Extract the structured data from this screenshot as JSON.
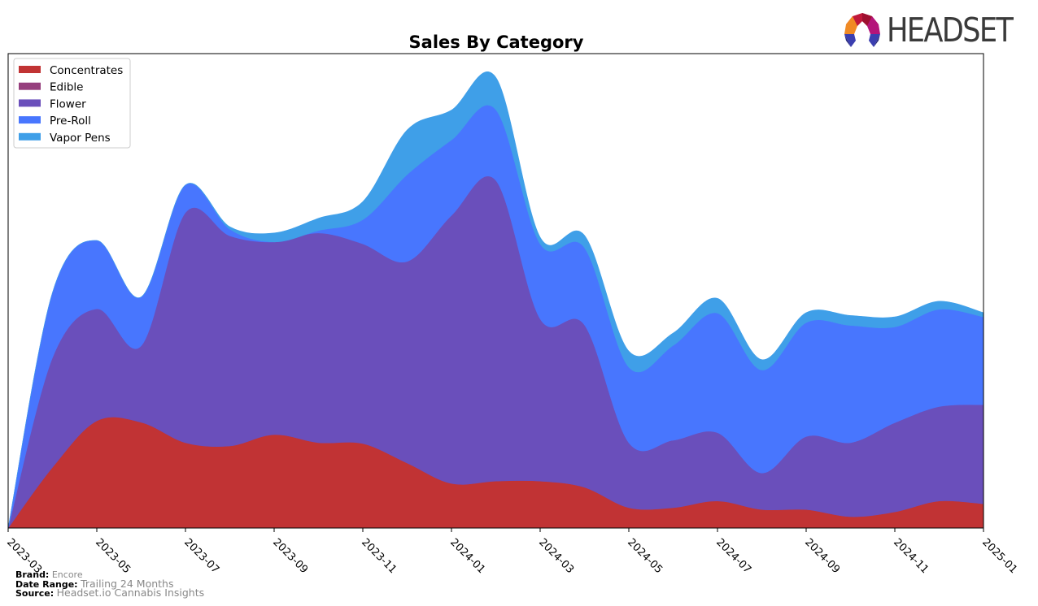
{
  "header": {
    "logo_text": "HEADSET"
  },
  "footer": {
    "brand_label": "Brand:",
    "brand_value": "Encore",
    "date_range_label": "Date Range:",
    "date_range_value": "Trailing 24 Months",
    "source_label": "Source:",
    "source_value": "Headset.io Cannabis Insights"
  },
  "chart_data": {
    "type": "area",
    "stacked": true,
    "smooth": true,
    "title": "Sales By Category",
    "xlabel": "",
    "ylabel": "",
    "y_axis_visible": false,
    "ylim": [
      0,
      100
    ],
    "grid": false,
    "legend_position": "top-left",
    "x": [
      "2023-03",
      "2023-04",
      "2023-05",
      "2023-06",
      "2023-07",
      "2023-08",
      "2023-09",
      "2023-10",
      "2023-11",
      "2023-12",
      "2024-01",
      "2024-02",
      "2024-03",
      "2024-04",
      "2024-05",
      "2024-06",
      "2024-07",
      "2024-08",
      "2024-09",
      "2024-10",
      "2024-11",
      "2024-12",
      "2025-01"
    ],
    "x_tick_labels": [
      "2023-03",
      "2023-05",
      "2023-07",
      "2023-09",
      "2023-11",
      "2024-01",
      "2024-03",
      "2024-05",
      "2024-07",
      "2024-09",
      "2024-11",
      "2025-01"
    ],
    "series": [
      {
        "name": "Concentrates",
        "color": "#c13334",
        "values": [
          0,
          12.8,
          22.6,
          22.3,
          18.0,
          17.3,
          19.7,
          18.0,
          17.8,
          13.7,
          9.4,
          9.9,
          9.9,
          8.6,
          4.3,
          4.3,
          5.7,
          3.9,
          3.9,
          2.4,
          3.4,
          5.7,
          5.1
        ]
      },
      {
        "name": "Edible",
        "color": "#963f7d",
        "values": [
          0,
          0,
          0,
          0,
          0,
          0,
          0,
          0,
          0,
          0,
          0,
          0,
          0,
          0,
          0,
          0,
          0,
          0,
          0,
          0,
          0,
          0,
          0
        ]
      },
      {
        "name": "Flower",
        "color": "#6a4fbb",
        "values": [
          0,
          23.1,
          23.6,
          16.1,
          48.5,
          44.3,
          40.6,
          44.2,
          42.1,
          42.5,
          56.5,
          63.4,
          34.2,
          34.2,
          13.7,
          14.2,
          14.4,
          7.7,
          15.4,
          15.6,
          18.8,
          19.9,
          20.9
        ]
      },
      {
        "name": "Pre-Roll",
        "color": "#4876fe",
        "values": [
          0,
          13.7,
          14.4,
          10.3,
          5.8,
          1.4,
          0,
          0.5,
          5.1,
          18.3,
          15.9,
          14.9,
          15.8,
          16.3,
          15.9,
          20.0,
          25.2,
          21.7,
          24.0,
          24.7,
          20.2,
          20.5,
          18.5
        ]
      },
      {
        "name": "Vapor Pens",
        "color": "#3f9fe8",
        "values": [
          0,
          0,
          0,
          0,
          0,
          0.5,
          1.9,
          2.6,
          3.8,
          9.4,
          6.3,
          6.8,
          1.4,
          2.6,
          3.4,
          2.6,
          3.1,
          2.2,
          2.1,
          2.1,
          2.1,
          1.7,
          0.9
        ]
      }
    ]
  }
}
